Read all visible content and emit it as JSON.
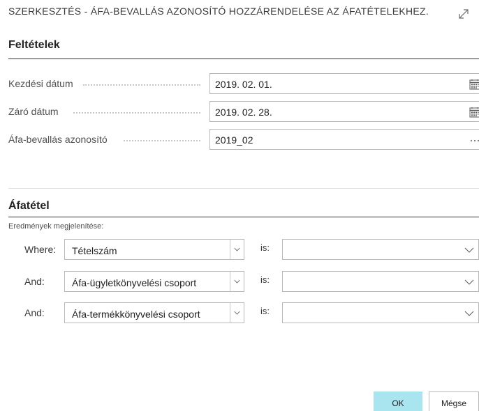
{
  "dialog": {
    "title": "SZERKESZTÉS - ÁFA-BEVALLÁS AZONOSÍTÓ HOZZÁRENDELÉSE AZ ÁFATÉTELEKHEZ."
  },
  "conditions": {
    "heading": "Feltételek",
    "fields": [
      {
        "label": "Kezdési dátum",
        "value": "2019. 02. 01.",
        "icon": "calendar-icon"
      },
      {
        "label": "Záró dátum",
        "value": "2019. 02. 28.",
        "icon": "calendar-icon"
      },
      {
        "label": "Áfa-bevallás azonosító",
        "value": "2019_02",
        "icon": "ellipsis-icon"
      }
    ]
  },
  "filters": {
    "heading": "Áfatétel",
    "results_label": "Eredmények megjelenítése:",
    "is_label": "is:",
    "rows": [
      {
        "keyword": "Where:",
        "field": "Tételszám",
        "value": ""
      },
      {
        "keyword": "And:",
        "field": "Áfa-ügyletkönyvelési csoport",
        "value": ""
      },
      {
        "keyword": "And:",
        "field": "Áfa-termékkönyvelési csoport",
        "value": ""
      }
    ]
  },
  "buttons": {
    "ok": "OK",
    "cancel": "Mégse"
  },
  "colors": {
    "ok_button": "#a9e5ef"
  }
}
